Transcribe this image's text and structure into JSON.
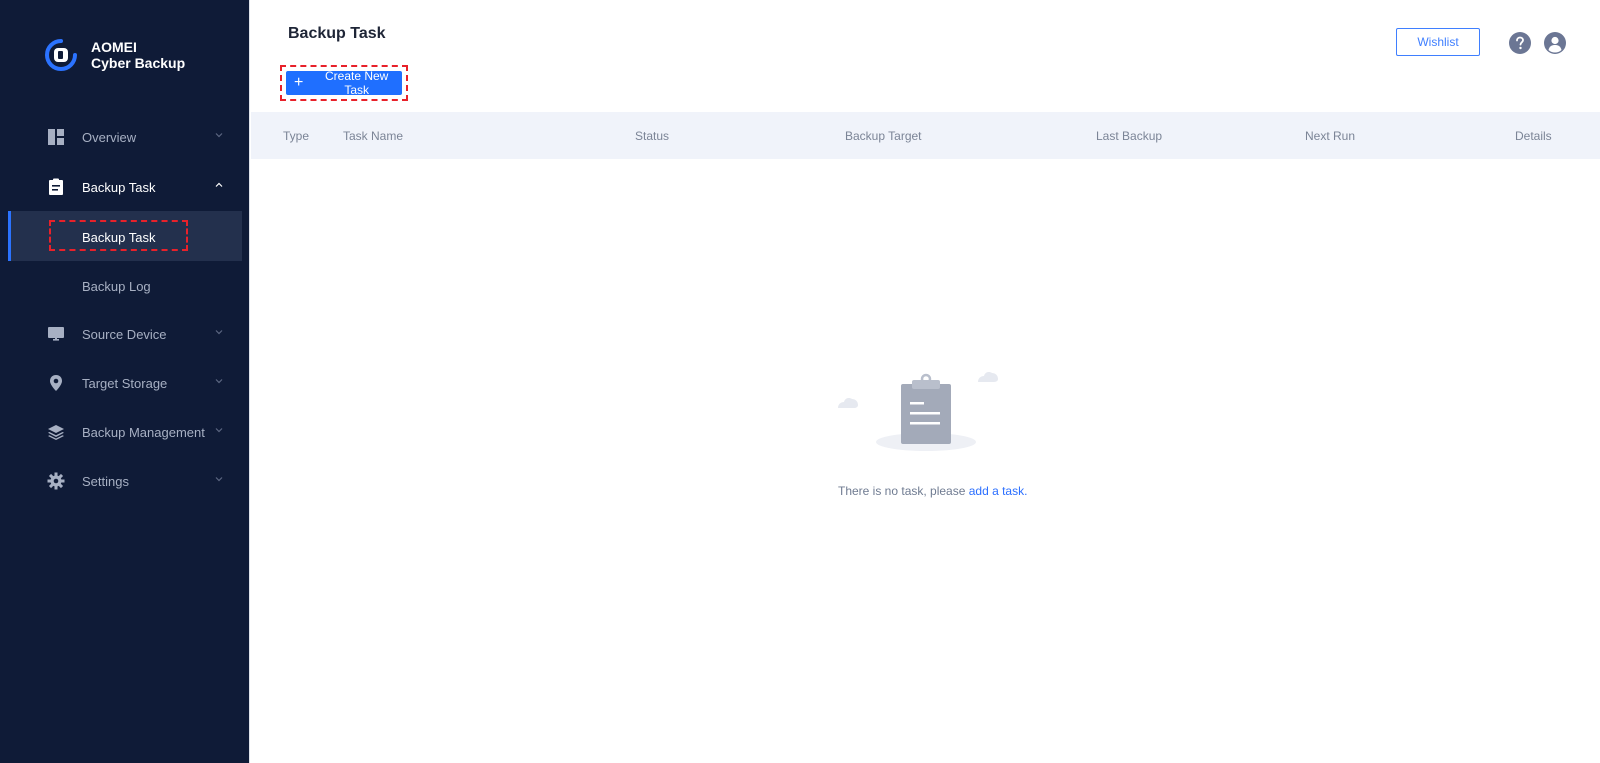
{
  "brand": {
    "line1": "AOMEI",
    "line2": "Cyber Backup"
  },
  "sidebar": {
    "items": [
      {
        "label": "Overview",
        "icon": "dashboard-icon"
      },
      {
        "label": "Backup Task",
        "icon": "clipboard-icon",
        "open": true
      },
      {
        "label": "Source Device",
        "icon": "monitor-icon"
      },
      {
        "label": "Target Storage",
        "icon": "location-pin-icon"
      },
      {
        "label": "Backup Management",
        "icon": "layers-icon"
      },
      {
        "label": "Settings",
        "icon": "gear-icon"
      }
    ],
    "subitems": [
      {
        "label": "Backup Task",
        "active": true
      },
      {
        "label": "Backup Log",
        "active": false
      }
    ]
  },
  "header": {
    "title": "Backup Task",
    "create_label": "Create New Task",
    "wishlist_label": "Wishlist"
  },
  "table": {
    "columns": [
      "Type",
      "Task Name",
      "Status",
      "Backup Target",
      "Last Backup",
      "Next Run",
      "Details"
    ]
  },
  "empty": {
    "text": "There is no task, please ",
    "link": "add a task."
  },
  "colors": {
    "sidebar_bg": "#0f1b37",
    "accent": "#1f6fff",
    "highlight_border": "#e8212a",
    "table_header_bg": "#f0f3fa"
  }
}
